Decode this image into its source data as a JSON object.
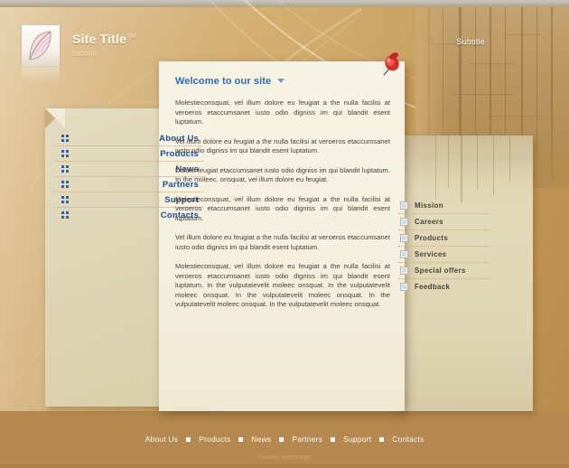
{
  "header": {
    "logo_icon": "leaf-logo-icon",
    "site_title": "Site Title",
    "trademark": "TM",
    "site_subtitle": "subtitle",
    "right_subtitle": "Subtitle"
  },
  "left_nav": {
    "items": [
      {
        "label": "About Us",
        "icon": "four-dots-icon"
      },
      {
        "label": "Products",
        "icon": "four-dots-icon"
      },
      {
        "label": "News",
        "icon": "four-dots-icon"
      },
      {
        "label": "Partners",
        "icon": "four-dots-icon"
      },
      {
        "label": "Support",
        "icon": "four-dots-icon"
      },
      {
        "label": "Contacts",
        "icon": "four-dots-icon"
      }
    ]
  },
  "main": {
    "heading": "Welcome to our site",
    "heading_icon": "chevron-down-icon",
    "pin_icon": "red-pushpin-icon",
    "paragraphs": [
      "Molestieconsquat, vel illum dolore eu feugiat a the nulla facilisi at veroeros etaccumsanet iusto odio digniss im qui blandit esent luptatum.",
      "Vel illum dolore eu feugiat a the nulla facilisi at veroeros etaccumsanet iusto odio digniss im qui blandit esent luptatum.",
      "Dolore feugiat   etaccumsanet iusto odio digniss im qui blandit luptatum. In the moleec. onsquat, vel illum dolore eu feugiat.",
      "Molestieconsquat, vel illum dolore eu feugiat a the nulla facilisi at veroeros etaccumsanet iusto odio digniss im qui blandit esent luptatum.",
      "Vel illum dolore eu feugiat a the nulla facilisi at veroeros etaccumsanet iusto odio digniss im qui blandit esent luptatum.",
      "Molestieconsquat, vel illum dolore eu feugiat a the nulla facilisi at veroeros etaccumsanet iusto odio digniss im qui blandit esent luptatum. In the vulputatevelit moleec onsquat. In the vulputatevelit moleec onsquat. In the vulputatevelit moleec onsquat. In the vulputatevelit moleec onsquat. In the vulputatevelit moleec onsquat."
    ]
  },
  "right_nav": {
    "items": [
      {
        "label": "Mission",
        "icon": "square-bullet-icon"
      },
      {
        "label": "Careers",
        "icon": "square-bullet-icon"
      },
      {
        "label": "Products",
        "icon": "square-bullet-icon"
      },
      {
        "label": "Services",
        "icon": "square-bullet-icon"
      },
      {
        "label": "Special offers",
        "icon": "square-bullet-icon"
      },
      {
        "label": "Feedback",
        "icon": "square-bullet-icon"
      }
    ]
  },
  "footer": {
    "links": [
      "About Us",
      "Products",
      "News",
      "Partners",
      "Support",
      "Contacts"
    ],
    "message": "Footer message"
  },
  "colors": {
    "background_gold": "#c79a58",
    "footer_bronze": "#b5884f",
    "panel_cream": "#f4efdf",
    "panel_beige": "#e0d7b9",
    "link_blue": "#20508f",
    "heading_blue": "#2f6cb4",
    "pin_red": "#cf2c2c"
  }
}
